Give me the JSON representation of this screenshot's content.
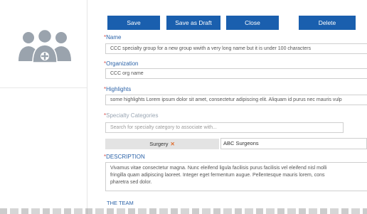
{
  "toolbar": {
    "save_label": "Save",
    "save_draft_label": "Save as Draft",
    "close_label": "Close",
    "delete_label": "Delete"
  },
  "form": {
    "name": {
      "required_mark": "*",
      "label": "Name",
      "value": "CCC specialty group for a new group wwith a very long name but it is under 100 characters"
    },
    "organization": {
      "required_mark": "*",
      "label": "Organization",
      "value": "CCC org name"
    },
    "highlights": {
      "required_mark": "*",
      "label": "Highlights",
      "value": "some highlights Lorem ipsum dolor sit amet, consectetur adipiscing elit. Aliquam id purus nec mauris vulp"
    },
    "specialty_categories": {
      "required_mark": "*",
      "label": "Specialty Categories",
      "placeholder": "Search for specialty category to associate with...",
      "selected_tag": "Surgery",
      "remove_symbol": "✕",
      "subcategory_value": "ABC Surgeons"
    },
    "description": {
      "required_mark": "*",
      "label": "DESCRIPTION",
      "lines": [
        "Vivamus vitae consectetur magna. Nunc eleifend ligula facilisis purus facilisis vel eleifend nisl molli",
        "fringilla quam adipiscing laoreet. Integer eget fermentum augue. Pellentesque mauris lorem, cons",
        "pharetra sed dolor."
      ]
    },
    "team_section_label": "THE TEAM"
  },
  "colors": {
    "primary_button": "#1a5fae",
    "label_blue": "#2c63a8",
    "required_red": "#d9534f",
    "remove_orange": "#e06b2b"
  },
  "icons": {
    "avatar": "group-add-icon"
  }
}
